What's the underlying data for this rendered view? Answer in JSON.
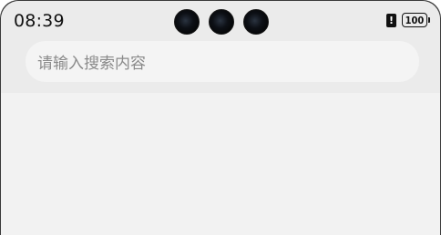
{
  "status_bar": {
    "time": "08:39",
    "alert_glyph": "!",
    "battery_level": "100"
  },
  "search": {
    "placeholder": "请输入搜索内容"
  }
}
